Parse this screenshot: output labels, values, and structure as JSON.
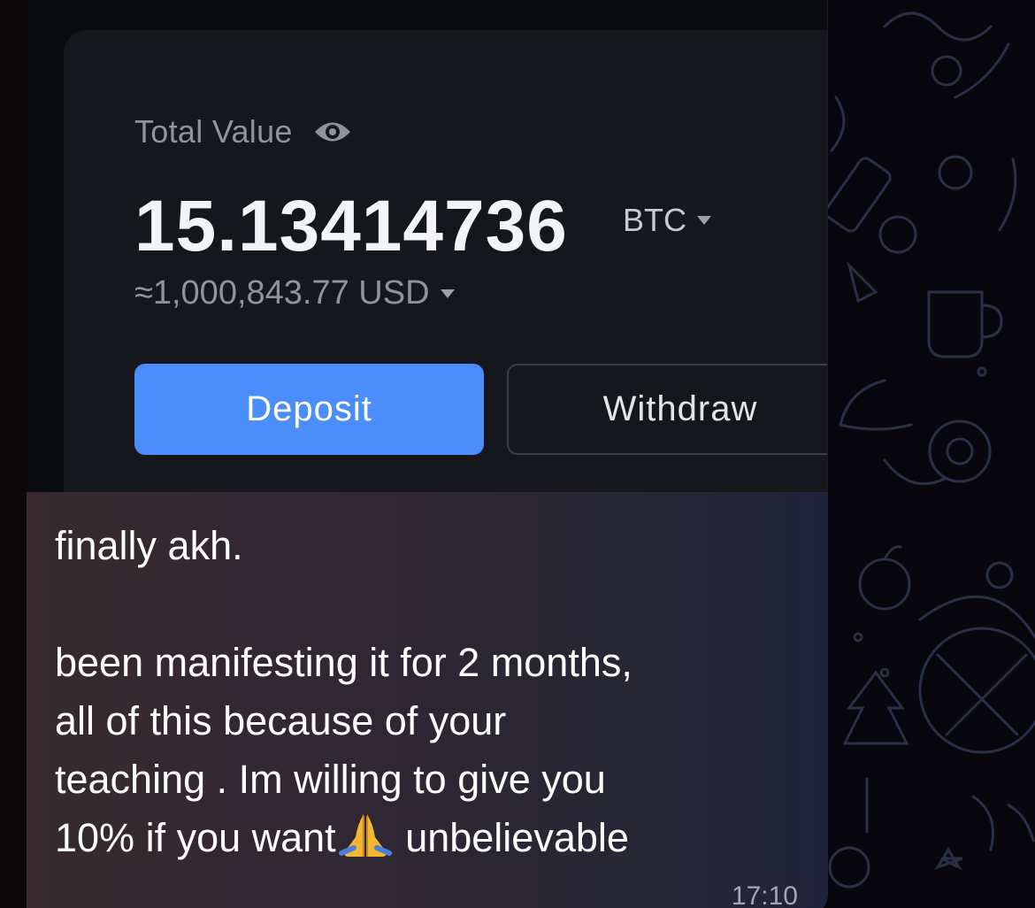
{
  "wallet": {
    "total_label": "Total Value",
    "btc_amount": "15.13414736",
    "btc_unit": "BTC",
    "usd_value": "≈1,000,843.77 USD",
    "deposit_label": "Deposit",
    "withdraw_label": "Withdraw"
  },
  "message": {
    "line1": "finally akh.",
    "line2": "been manifesting it for 2 months,",
    "line3": "all of this because of your",
    "line4": "teaching . Im willing to give you",
    "line5_pre": "10% if you want",
    "line5_post": " unbelievable",
    "emoji": "folded-hands-icon",
    "time": "17:10"
  },
  "colors": {
    "background": "#07070d",
    "card": "#15171d",
    "deposit_accent": "#4a8dfb",
    "bubble_left": "#382a2e",
    "bubble_right": "#20233a"
  }
}
